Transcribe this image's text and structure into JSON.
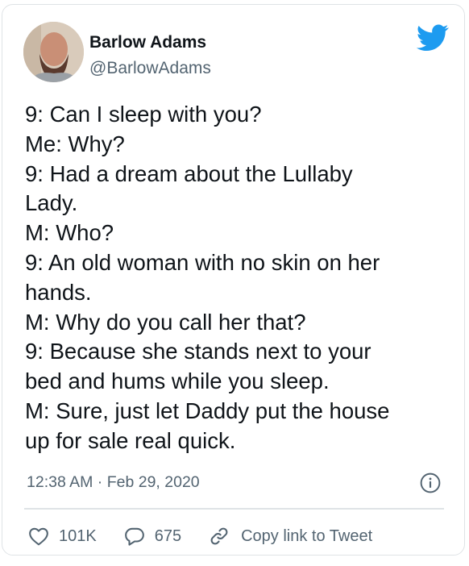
{
  "author": {
    "name": "Barlow Adams",
    "handle": "@BarlowAdams"
  },
  "tweet": {
    "lines": [
      "9: Can I sleep with you?",
      "Me: Why?",
      "9: Had a dream about the Lullaby",
      "Lady.",
      "M: Who?",
      "9: An old woman with no skin on her",
      "hands.",
      "M: Why do you call her that?",
      "9: Because she stands next to your",
      "bed and hums while you sleep.",
      "M: Sure, just let Daddy put the house",
      "up for sale real quick."
    ],
    "timestamp": "12:38 AM · Feb 29, 2020"
  },
  "actions": {
    "likes": "101K",
    "replies": "675",
    "copy_link_label": "Copy link to Tweet"
  },
  "icons": {
    "brand": "twitter-bird-icon",
    "info": "info-icon",
    "like": "heart-icon",
    "reply": "speech-bubble-icon",
    "copy": "link-icon"
  },
  "colors": {
    "brand_blue": "#1d9bf0",
    "text": "#0f1419",
    "secondary": "#536471",
    "border": "#dfe3e6"
  }
}
